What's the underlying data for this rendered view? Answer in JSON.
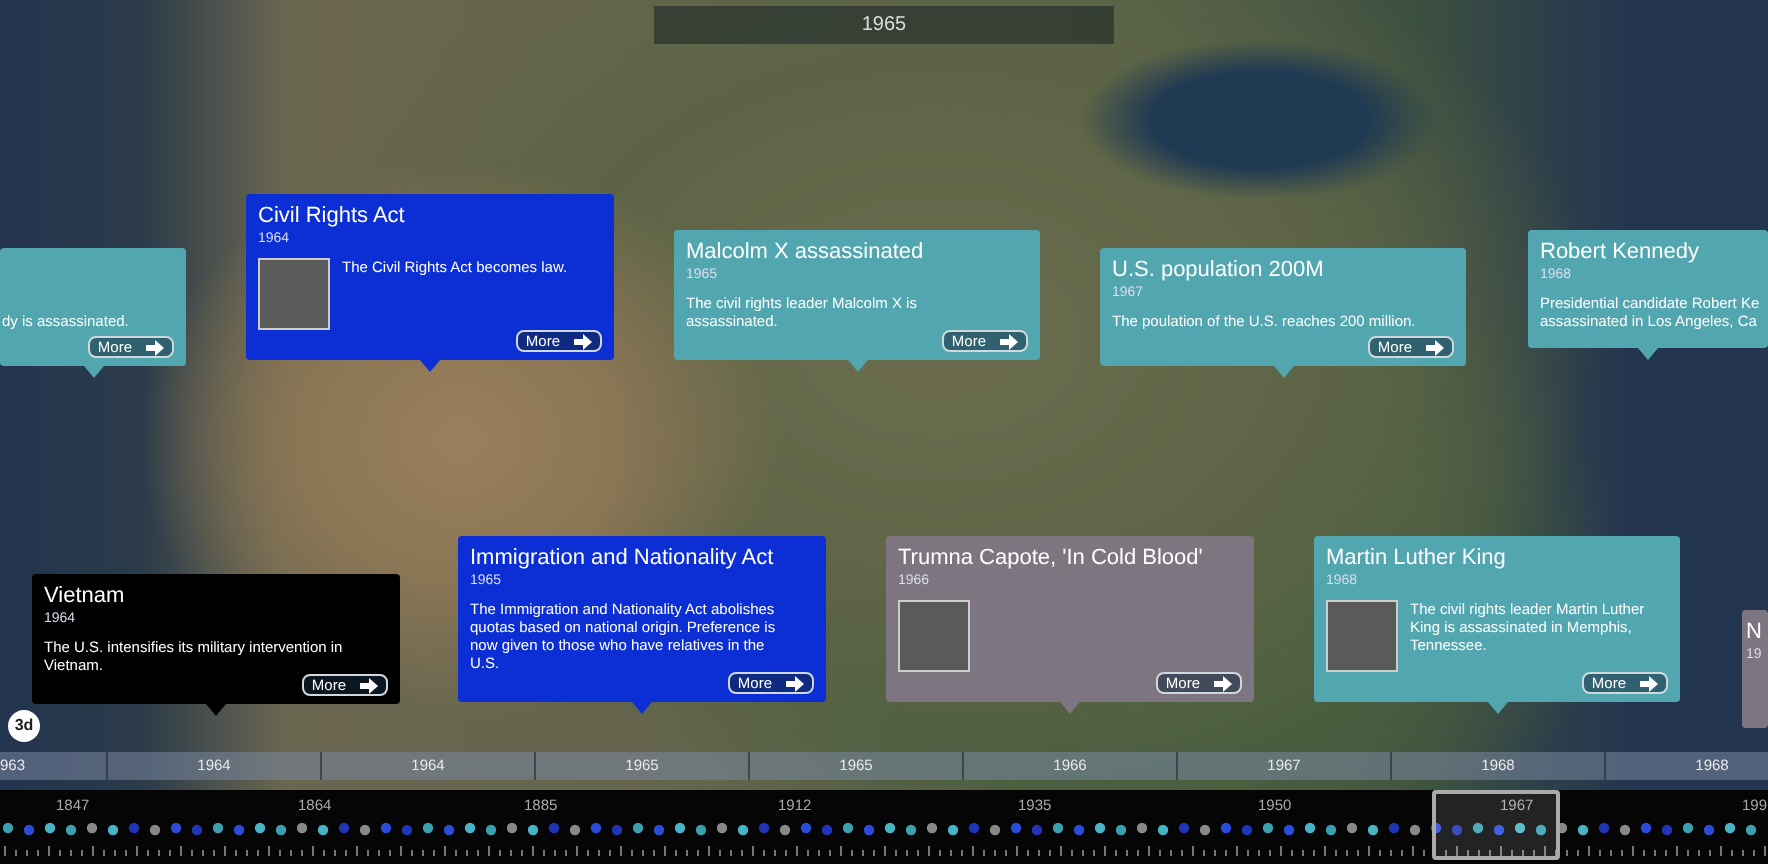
{
  "current_year": "1965",
  "cards": [
    {
      "text": "dy is assassinated.",
      "image": false,
      "color": "#52a6b0",
      "more": "More"
    },
    {
      "title": "Civil Rights Act",
      "year": "1964",
      "text": "The Civil Rights Act becomes law.",
      "image": true,
      "color": "#0b2fd4",
      "more": "More"
    },
    {
      "title": "Malcolm X assassinated",
      "year": "1965",
      "text": "The civil rights leader Malcolm X is\nassassinated.",
      "image": false,
      "color": "#52a6b0",
      "more": "More"
    },
    {
      "title": "U.S. population 200M",
      "year": "1967",
      "text": "The poulation of the U.S. reaches 200 million.",
      "image": false,
      "color": "#52a6b0",
      "more": "More"
    },
    {
      "title": "Robert Kennedy",
      "year": "1968",
      "text": "Presidential candidate Robert Ke\nassassinated in Los Angeles, Ca",
      "image": false,
      "color": "#52a6b0"
    },
    {
      "title": "Vietnam",
      "year": "1964",
      "text": "The U.S. intensifies its military intervention in\nVietnam.",
      "image": false,
      "color": "#000000",
      "more": "More"
    },
    {
      "title": "Immigration and Nationality Act",
      "year": "1965",
      "text": "The Immigration and Nationality Act abolishes\nquotas based on national origin. Preference is\nnow given to those who have relatives in the\nU.S.",
      "image": false,
      "color": "#0b2fd4",
      "more": "More"
    },
    {
      "title": "Trumna Capote, 'In Cold Blood'",
      "year": "1966",
      "image": true,
      "color": "#7d7680",
      "more": "More"
    },
    {
      "title": "Martin Luther King",
      "year": "1968",
      "text": "The civil rights leader Martin Luther\nKing is assassinated in Memphis,\nTennessee.",
      "image": true,
      "color": "#52a6b0",
      "more": "More"
    },
    {
      "title": "N",
      "year": "19",
      "image": false,
      "color": "#7d7680"
    }
  ],
  "view_mode": "3d",
  "axis_labels": [
    "963",
    "1964",
    "1964",
    "1965",
    "1965",
    "1966",
    "1967",
    "1968",
    "1968"
  ],
  "overview_labels": [
    "1847",
    "1864",
    "1885",
    "1912",
    "1935",
    "1950",
    "1967",
    "199"
  ]
}
